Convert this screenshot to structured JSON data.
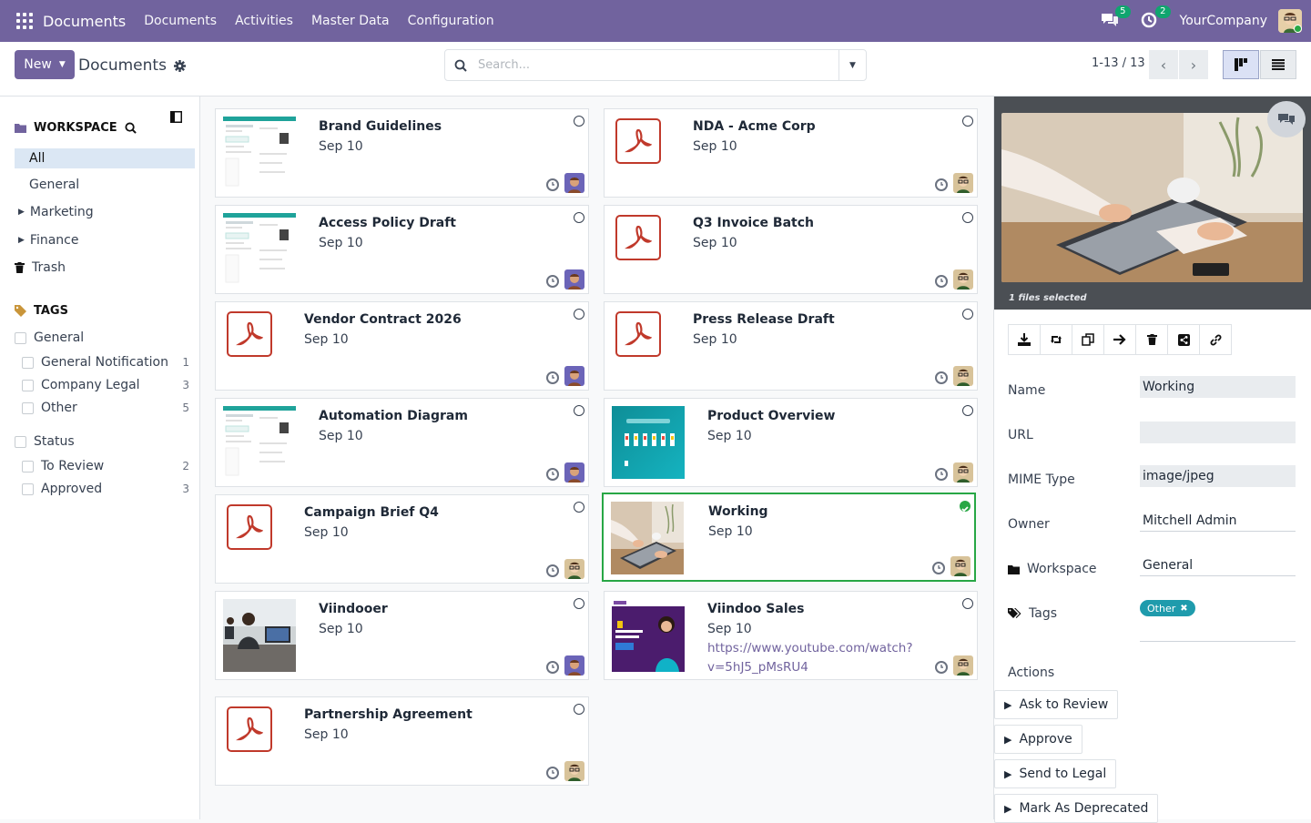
{
  "topbar": {
    "app_title": "Documents",
    "menus": [
      "Documents",
      "Activities",
      "Master Data",
      "Configuration"
    ],
    "chat_count": "5",
    "activity_count": "2",
    "company": "YourCompany"
  },
  "cp": {
    "new_label": "New",
    "breadcrumb": "Documents",
    "search_placeholder": "Search...",
    "pager": "1-13 / 13"
  },
  "sidebar": {
    "workspace_title": "WORKSPACE",
    "items": [
      "All",
      "General",
      "Marketing",
      "Finance",
      "Trash"
    ],
    "tags_title": "TAGS",
    "tag_groups": [
      {
        "label": "General",
        "tags": [
          {
            "label": "General Notification",
            "count": "1"
          },
          {
            "label": "Company Legal",
            "count": "3"
          },
          {
            "label": "Other",
            "count": "5"
          }
        ]
      },
      {
        "label": "Status",
        "tags": [
          {
            "label": "To Review",
            "count": "2"
          },
          {
            "label": "Approved",
            "count": "3"
          }
        ]
      }
    ]
  },
  "cards": [
    {
      "title": "Brand Guidelines",
      "date": "Sep 10"
    },
    {
      "title": "NDA - Acme Corp",
      "date": "Sep 10"
    },
    {
      "title": "Access Policy Draft",
      "date": "Sep 10"
    },
    {
      "title": "Q3 Invoice Batch",
      "date": "Sep 10"
    },
    {
      "title": "Vendor Contract 2026",
      "date": "Sep 10"
    },
    {
      "title": "Press Release Draft",
      "date": "Sep 10"
    },
    {
      "title": "Automation Diagram",
      "date": "Sep 10"
    },
    {
      "title": "Product Overview",
      "date": "Sep 10"
    },
    {
      "title": "Campaign Brief Q4",
      "date": "Sep 10"
    },
    {
      "title": "Working",
      "date": "Sep 10"
    },
    {
      "title": "Viindooer",
      "date": "Sep 10"
    },
    {
      "title": "Viindoo Sales",
      "date": "Sep 10",
      "link1": "https://www.youtube.com/watch?",
      "link2": "v=5hJ5_pMsRU4"
    },
    {
      "title": "Partnership Agreement",
      "date": "Sep 10"
    }
  ],
  "panel": {
    "caption": "1 files selected",
    "fields": {
      "name_label": "Name",
      "name_value": "Working",
      "url_label": "URL",
      "url_value": "",
      "mime_label": "MIME Type",
      "mime_value": "image/jpeg",
      "owner_label": "Owner",
      "owner_value": "Mitchell Admin",
      "workspace_label": "Workspace",
      "workspace_value": "General",
      "tags_label": "Tags",
      "tag_value": "Other"
    },
    "actions_title": "Actions",
    "actions": [
      "Ask to Review",
      "Approve",
      "Send to Legal",
      "Mark As Deprecated"
    ]
  }
}
